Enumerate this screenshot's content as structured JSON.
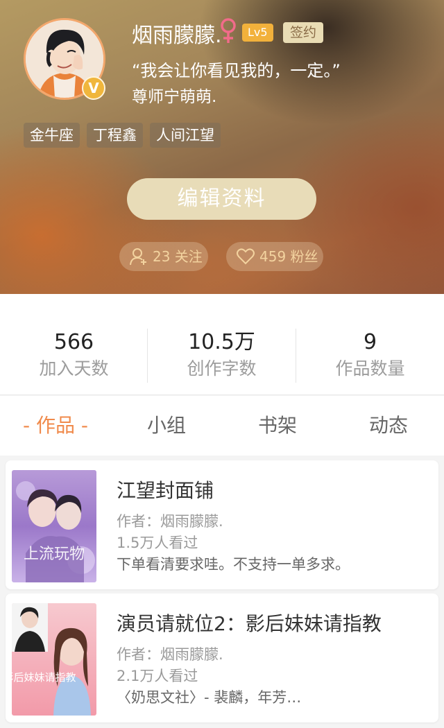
{
  "profile": {
    "username": "烟雨朦朦.",
    "level": "Lv5",
    "sign_badge": "签约",
    "v_badge": "V",
    "bio_line1": "“我会让你看见我的，一定。”",
    "bio_line2": "尊师宁萌萌.",
    "tags": [
      "金牛座",
      "丁程鑫",
      "人间江望"
    ],
    "edit_button": "编辑资料",
    "following_label": "23 关注",
    "followers_label": "459 粉丝"
  },
  "stats": [
    {
      "value": "566",
      "label": "加入天数"
    },
    {
      "value": "10.5万",
      "label": "创作字数"
    },
    {
      "value": "9",
      "label": "作品数量"
    }
  ],
  "tabs": [
    {
      "label": "- 作品 -",
      "active": true
    },
    {
      "label": "小组",
      "active": false
    },
    {
      "label": "书架",
      "active": false
    },
    {
      "label": "动态",
      "active": false
    }
  ],
  "works": [
    {
      "title": "江望封面铺",
      "author": "作者：烟雨朦朦.",
      "views": "1.5万人看过",
      "desc": "下单看清要求哇。不支持一单多求。",
      "cover_text": "上流玩物"
    },
    {
      "title": "演员请就位2：影后妹妹请指教",
      "author": "作者：烟雨朦朦.",
      "views": "2.1万人看过",
      "desc": "〈奶思文社〉- 裴麟，年芳…",
      "cover_text": "影后妹妹请指教"
    }
  ],
  "colors": {
    "accent": "#f08a4b",
    "level_badge": "#f2b13b",
    "sign_badge_bg": "#e9dcb4",
    "edit_button_bg": "#e8dcb8",
    "pill_text": "#f3d39f"
  }
}
